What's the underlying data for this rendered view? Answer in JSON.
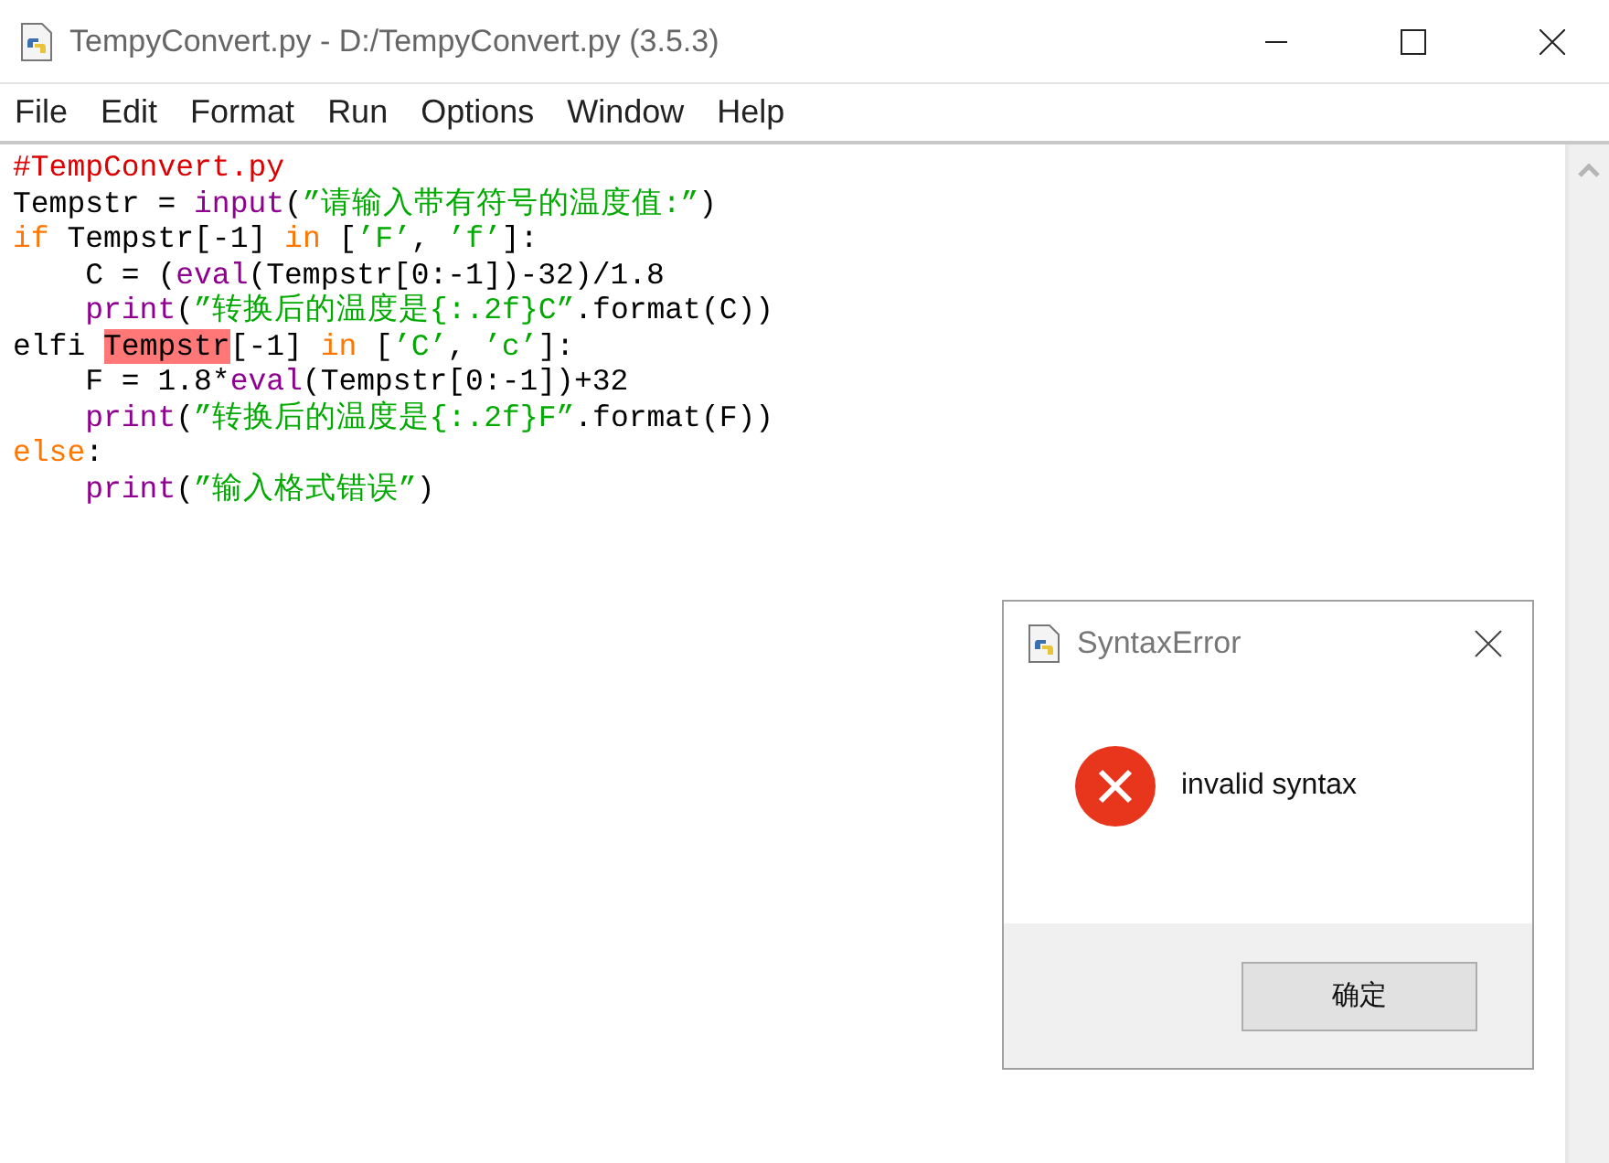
{
  "window": {
    "title": "TempyConvert.py - D:/TempyConvert.py (3.5.3)"
  },
  "menu": [
    "File",
    "Edit",
    "Format",
    "Run",
    "Options",
    "Window",
    "Help"
  ],
  "code_lines": [
    {
      "indented": false,
      "tokens": [
        {
          "kind": "comment",
          "text": "#TempConvert.py"
        }
      ]
    },
    {
      "indented": false,
      "tokens": [
        {
          "kind": "plain",
          "text": "Tempstr = "
        },
        {
          "kind": "builtin",
          "text": "input"
        },
        {
          "kind": "plain",
          "text": "("
        },
        {
          "kind": "string",
          "text": "”请输入带有符号的温度值:”"
        },
        {
          "kind": "plain",
          "text": ")"
        }
      ]
    },
    {
      "indented": false,
      "tokens": [
        {
          "kind": "keyword",
          "text": "if"
        },
        {
          "kind": "plain",
          "text": " Tempstr[-1] "
        },
        {
          "kind": "keyword",
          "text": "in"
        },
        {
          "kind": "plain",
          "text": " ["
        },
        {
          "kind": "string",
          "text": "’F’"
        },
        {
          "kind": "plain",
          "text": ", "
        },
        {
          "kind": "string",
          "text": "’f’"
        },
        {
          "kind": "plain",
          "text": "]:"
        }
      ]
    },
    {
      "indented": true,
      "tokens": [
        {
          "kind": "plain",
          "text": "C = ("
        },
        {
          "kind": "builtin",
          "text": "eval"
        },
        {
          "kind": "plain",
          "text": "(Tempstr[0:-1])-32)/1.8"
        }
      ]
    },
    {
      "indented": true,
      "tokens": [
        {
          "kind": "builtin",
          "text": "print"
        },
        {
          "kind": "plain",
          "text": "("
        },
        {
          "kind": "string",
          "text": "”转换后的温度是{:.2f}C”"
        },
        {
          "kind": "plain",
          "text": ".format(C))"
        }
      ]
    },
    {
      "indented": false,
      "tokens": [
        {
          "kind": "plain",
          "text": "elfi "
        },
        {
          "kind": "error",
          "text": "Tempstr"
        },
        {
          "kind": "plain",
          "text": "[-1] "
        },
        {
          "kind": "keyword",
          "text": "in"
        },
        {
          "kind": "plain",
          "text": " ["
        },
        {
          "kind": "string",
          "text": "’C’"
        },
        {
          "kind": "plain",
          "text": ", "
        },
        {
          "kind": "string",
          "text": "’c’"
        },
        {
          "kind": "plain",
          "text": "]:"
        }
      ]
    },
    {
      "indented": true,
      "tokens": [
        {
          "kind": "plain",
          "text": "F = 1.8*"
        },
        {
          "kind": "builtin",
          "text": "eval"
        },
        {
          "kind": "plain",
          "text": "(Tempstr[0:-1])+32"
        }
      ]
    },
    {
      "indented": true,
      "tokens": [
        {
          "kind": "builtin",
          "text": "print"
        },
        {
          "kind": "plain",
          "text": "("
        },
        {
          "kind": "string",
          "text": "”转换后的温度是{:.2f}F”"
        },
        {
          "kind": "plain",
          "text": ".format(F))"
        }
      ]
    },
    {
      "indented": false,
      "tokens": [
        {
          "kind": "keyword",
          "text": "else"
        },
        {
          "kind": "plain",
          "text": ":"
        }
      ]
    },
    {
      "indented": true,
      "tokens": [
        {
          "kind": "builtin",
          "text": "print"
        },
        {
          "kind": "plain",
          "text": "("
        },
        {
          "kind": "string",
          "text": "”输入格式错误”"
        },
        {
          "kind": "plain",
          "text": ")"
        }
      ]
    }
  ],
  "dialog": {
    "title": "SyntaxError",
    "message": "invalid syntax",
    "button": "确定"
  }
}
